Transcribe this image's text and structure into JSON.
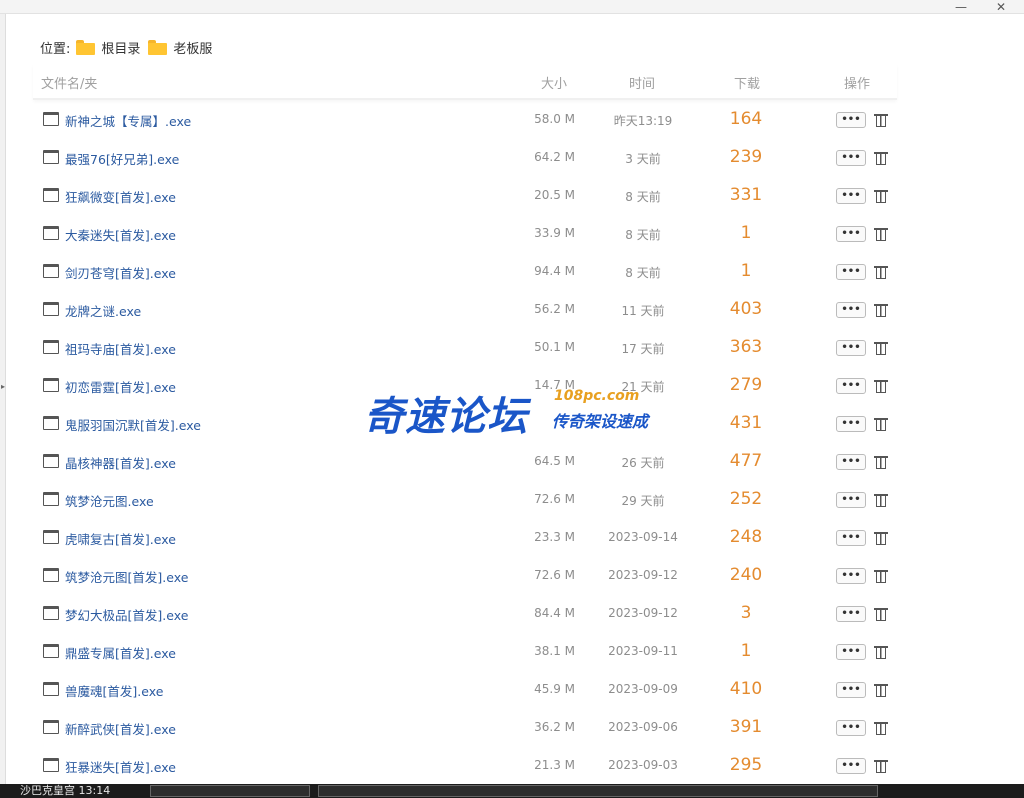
{
  "window": {
    "minimize": "—",
    "close": "✕"
  },
  "breadcrumb": {
    "label": "位置:",
    "items": [
      "根目录",
      "老板服"
    ]
  },
  "table": {
    "headers": {
      "name": "文件名/夹",
      "size": "大小",
      "time": "时间",
      "downloads": "下载",
      "actions": "操作"
    },
    "more_label": "•••",
    "rows": [
      {
        "name": "新神之城【专属】.exe",
        "size": "58.0 M",
        "time": "昨天13:19",
        "downloads": "164"
      },
      {
        "name": "最强76[好兄弟].exe",
        "size": "64.2 M",
        "time": "3 天前",
        "downloads": "239"
      },
      {
        "name": "狂飙微变[首发].exe",
        "size": "20.5 M",
        "time": "8 天前",
        "downloads": "331"
      },
      {
        "name": "大秦迷失[首发].exe",
        "size": "33.9 M",
        "time": "8 天前",
        "downloads": "1"
      },
      {
        "name": "剑刃苍穹[首发].exe",
        "size": "94.4 M",
        "time": "8 天前",
        "downloads": "1"
      },
      {
        "name": "龙牌之谜.exe",
        "size": "56.2 M",
        "time": "11 天前",
        "downloads": "403"
      },
      {
        "name": "祖玛寺庙[首发].exe",
        "size": "50.1 M",
        "time": "17 天前",
        "downloads": "363"
      },
      {
        "name": "初恋雷霆[首发].exe",
        "size": "14.7 M",
        "time": "21 天前",
        "downloads": "279"
      },
      {
        "name": "鬼服羽国沉默[首发].exe",
        "size": "",
        "time": "",
        "downloads": "431"
      },
      {
        "name": "晶核神器[首发].exe",
        "size": "64.5 M",
        "time": "26 天前",
        "downloads": "477"
      },
      {
        "name": "筑梦沧元图.exe",
        "size": "72.6 M",
        "time": "29 天前",
        "downloads": "252"
      },
      {
        "name": "虎啸复古[首发].exe",
        "size": "23.3 M",
        "time": "2023-09-14",
        "downloads": "248"
      },
      {
        "name": "筑梦沧元图[首发].exe",
        "size": "72.6 M",
        "time": "2023-09-12",
        "downloads": "240"
      },
      {
        "name": "梦幻大极品[首发].exe",
        "size": "84.4 M",
        "time": "2023-09-12",
        "downloads": "3"
      },
      {
        "name": "鼎盛专属[首发].exe",
        "size": "38.1 M",
        "time": "2023-09-11",
        "downloads": "1"
      },
      {
        "name": "兽魔魂[首发].exe",
        "size": "45.9 M",
        "time": "2023-09-09",
        "downloads": "410"
      },
      {
        "name": "新醉武侠[首发].exe",
        "size": "36.2 M",
        "time": "2023-09-06",
        "downloads": "391"
      },
      {
        "name": "狂暴迷失[首发].exe",
        "size": "21.3 M",
        "time": "2023-09-03",
        "downloads": "295"
      }
    ]
  },
  "watermark": {
    "main": "奇速论坛",
    "url": "108pc.com",
    "sub": "传奇架设速成"
  },
  "taskbar": {
    "label": "沙巴克皇宫 13:14"
  },
  "colors": {
    "link": "#2b5aa0",
    "downloads": "#e48b2f",
    "muted": "#8d8d8d",
    "folder": "#ffc532",
    "watermark": "#1a56c8"
  }
}
